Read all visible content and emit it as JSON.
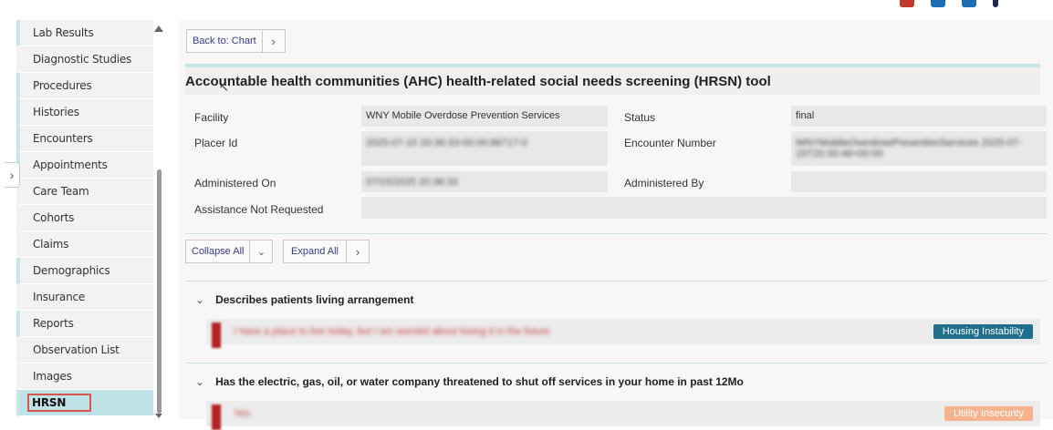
{
  "sidebar": {
    "items": [
      {
        "label": "Lab Results",
        "style": "teal"
      },
      {
        "label": "Diagnostic Studies",
        "style": "plain"
      },
      {
        "label": "Procedures",
        "style": "teal"
      },
      {
        "label": "Histories",
        "style": "teal"
      },
      {
        "label": "Encounters",
        "style": "teal"
      },
      {
        "label": "Appointments",
        "style": "teal"
      },
      {
        "label": "Care Team",
        "style": "plain"
      },
      {
        "label": "Cohorts",
        "style": "plain"
      },
      {
        "label": "Claims",
        "style": "plain"
      },
      {
        "label": "Demographics",
        "style": "teal"
      },
      {
        "label": "Insurance",
        "style": "plain"
      },
      {
        "label": "Reports",
        "style": "teal"
      },
      {
        "label": "Observation List",
        "style": "plain"
      },
      {
        "label": "Images",
        "style": "plain"
      },
      {
        "label": "HRSN",
        "style": "active"
      }
    ]
  },
  "toolbar": {
    "back_label": "Back to: Chart"
  },
  "page": {
    "title": "Accountable health communities (AHC) health-related social needs screening (HRSN) tool"
  },
  "fields": {
    "facility_label": "Facility",
    "facility_value": "WNY Mobile Overdose Prevention Services",
    "status_label": "Status",
    "status_value": "final",
    "placer_label": "Placer Id",
    "placer_value": "2025-07-15 20:36:33-00:00:86717-0",
    "encounter_label": "Encounter Number",
    "encounter_value": "WNYMobileOverdosePreventionServices 2025-07-15T20:33:48+00:00",
    "administered_on_label": "Administered On",
    "administered_on_value": "07/15/2025 20:36:33",
    "administered_by_label": "Administered By",
    "assistance_label": "Assistance Not Requested"
  },
  "controls": {
    "collapse_all": "Collapse All",
    "expand_all": "Expand All"
  },
  "questions": [
    {
      "title": "Describes patients living arrangement",
      "answer": "I have a place to live today, but I am worried about losing it in the future",
      "badge": "Housing Instability"
    },
    {
      "title": "Has the electric, gas, oil, or water company threatened to shut off services in your home in past 12Mo",
      "answer": "Yes",
      "badge": "Utility Insecurity"
    }
  ],
  "colors": {
    "accent": "#c6e6e8",
    "badge_housing": "#1f6e8c",
    "badge_utility": "#f6b38e",
    "answer_marker": "#b22222"
  }
}
